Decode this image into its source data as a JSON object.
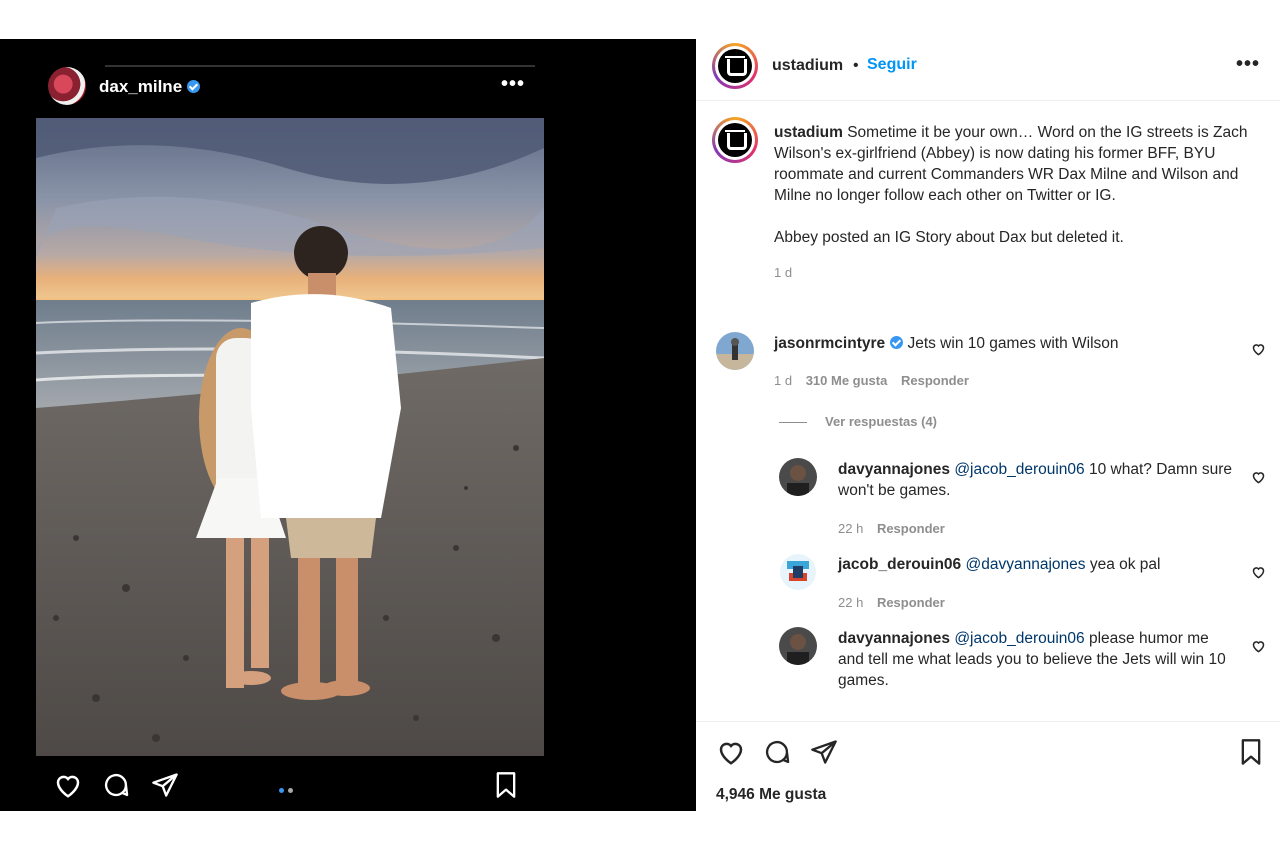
{
  "left_post": {
    "username": "dax_milne",
    "verified": true,
    "more_label": "•••",
    "carousel_dots": {
      "count": 2,
      "active_index": 0,
      "active_color": "#3897f0",
      "inactive_color": "#a8a8a8"
    },
    "icons": [
      "heart-icon",
      "comment-icon",
      "share-icon",
      "bookmark-icon"
    ]
  },
  "right_post": {
    "header": {
      "username": "ustadium",
      "separator": "•",
      "follow_label": "Seguir",
      "more_label": "•••"
    },
    "caption": {
      "username": "ustadium",
      "text1": "Sometime it be your own… Word on the IG streets is Zach Wilson's ex-girlfriend (Abbey) is now dating his former BFF, BYU roommate and current Commanders WR Dax Milne and Wilson and Milne no longer follow each other on Twitter or IG.",
      "text2": "Abbey posted an IG Story about Dax but deleted it.",
      "time": "1 d"
    },
    "comments": [
      {
        "username": "jasonrmcintyre",
        "verified": true,
        "text": "Jets win 10 games with Wilson",
        "time": "1 d",
        "likes": "310 Me gusta",
        "reply": "Responder"
      }
    ],
    "view_replies": "Ver respuestas (4)",
    "replies": [
      {
        "username": "davyannajones",
        "mention": "@jacob_derouin06",
        "text": "10 what? Damn sure won't be games.",
        "time": "22 h",
        "reply": "Responder"
      },
      {
        "username": "jacob_derouin06",
        "mention": "@davyannajones",
        "text": "yea ok pal",
        "time": "22 h",
        "reply": "Responder"
      },
      {
        "username": "davyannajones",
        "mention": "@jacob_derouin06",
        "text": "please humor me and tell me what leads you to believe the Jets will win 10 games."
      }
    ],
    "likes_count": "4,946 Me gusta",
    "icons": [
      "heart-icon",
      "comment-icon",
      "share-icon",
      "bookmark-icon"
    ]
  }
}
